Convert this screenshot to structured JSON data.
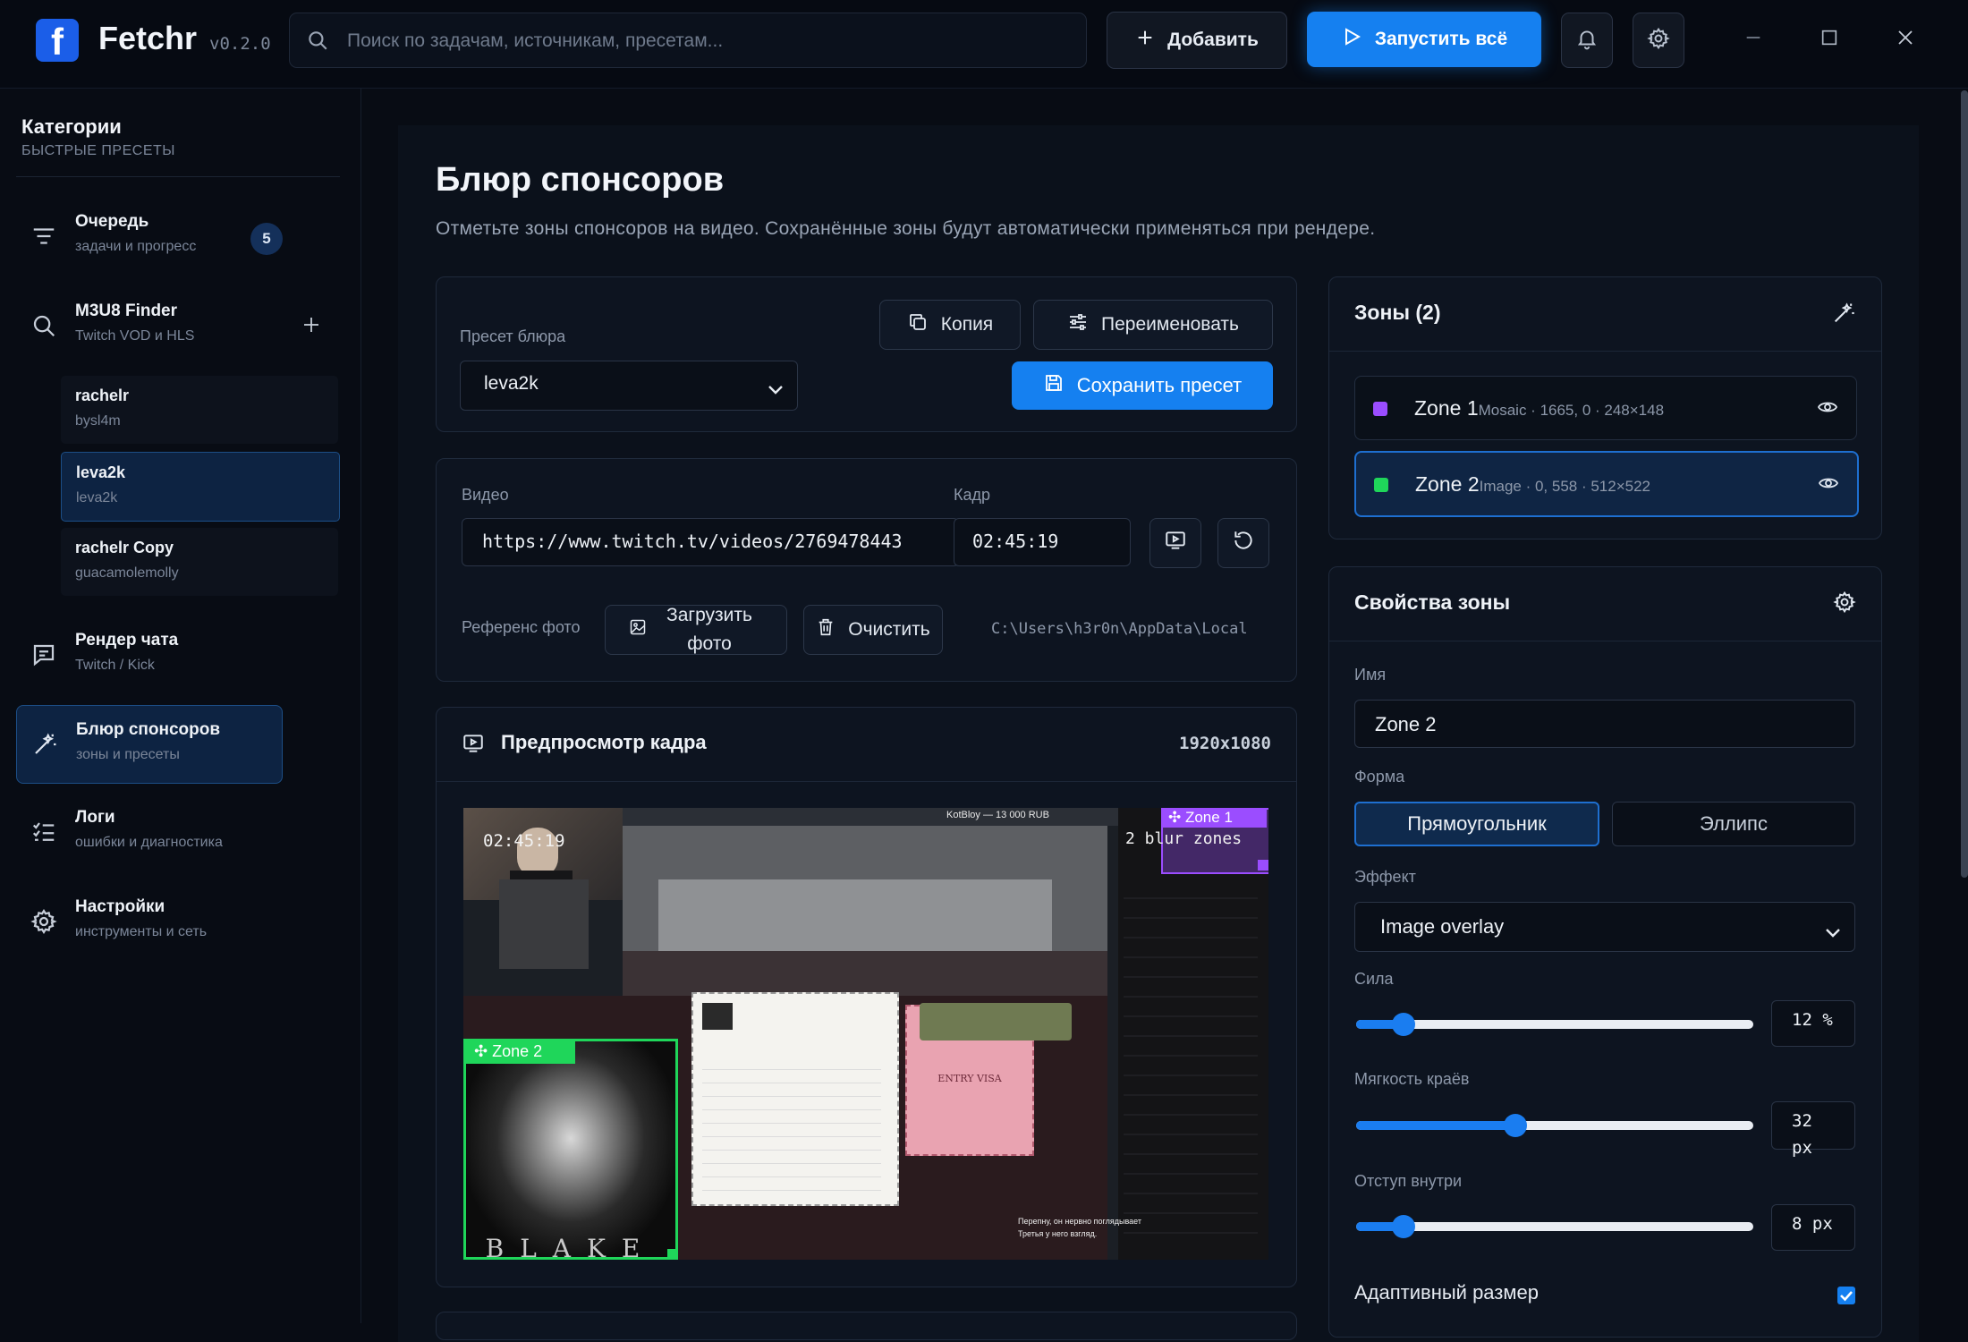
{
  "app": {
    "name": "Fetchr",
    "version": "v0.2.0",
    "logo_letter": "f"
  },
  "search": {
    "placeholder": "Поиск по задачам, источникам, пресетам..."
  },
  "toolbar": {
    "add_label": "Добавить",
    "run_all_label": "Запустить всё"
  },
  "sidebar": {
    "title": "Категории",
    "subtitle": "БЫСТРЫЕ ПРЕСЕТЫ",
    "queue": {
      "label": "Очередь",
      "sub": "задачи и прогресс",
      "badge": "5"
    },
    "m3u8": {
      "label": "M3U8 Finder",
      "sub": "Twitch VOD и HLS"
    },
    "m3u8_items": [
      {
        "name": "rachelr",
        "sub": "bysl4m"
      },
      {
        "name": "leva2k",
        "sub": "leva2k"
      },
      {
        "name": "rachelr Copy",
        "sub": "guacamolemolly"
      }
    ],
    "chat": {
      "label": "Рендер чата",
      "sub": "Twitch / Kick"
    },
    "blur": {
      "label": "Блюр спонсоров",
      "sub": "зоны и пресеты"
    },
    "logs": {
      "label": "Логи",
      "sub": "ошибки и диагностика"
    },
    "settings": {
      "label": "Настройки",
      "sub": "инструменты и сеть"
    }
  },
  "page": {
    "title": "Блюр спонсоров",
    "description": "Отметьте зоны спонсоров на видео. Сохранённые зоны будут автоматически применяться при рендере."
  },
  "preset": {
    "label": "Пресет блюра",
    "selected": "leva2k",
    "copy_label": "Копия",
    "rename_label": "Переименовать",
    "save_label": "Сохранить пресет"
  },
  "video": {
    "video_label": "Видео",
    "url": "https://www.twitch.tv/videos/2769478443",
    "frame_label": "Кадр",
    "frame": "02:45:19",
    "ref_label": "Референс фото",
    "upload_label": "Загрузить фото",
    "clear_label": "Очистить",
    "ref_path": "C:\\Users\\h3r0n\\AppData\\Local"
  },
  "preview": {
    "title": "Предпросмотр кадра",
    "resolution": "1920x1080",
    "timestamp": "02:45:19",
    "zone1_tag": "Zone 1",
    "zone2_tag": "Zone 2",
    "overlay_text": "2 blur zones",
    "art_text": "BLAKE",
    "game_banner": "KotBloy — 13 000 RUB",
    "entry_visa": "ENTRY VISA",
    "chat_line1": "Перепну, он нервно поглядывает",
    "chat_line2": "Третья у него взгляд."
  },
  "zones": {
    "title": "Зоны (2)",
    "items": [
      {
        "name": "Zone 1",
        "meta": "Mosaic · 1665, 0 · 248×148",
        "color": "#9b4dff"
      },
      {
        "name": "Zone 2",
        "meta": "Image · 0, 558 · 512×522",
        "color": "#1fd65a"
      }
    ]
  },
  "props": {
    "title": "Свойства зоны",
    "name_label": "Имя",
    "name_value": "Zone 2",
    "shape_label": "Форма",
    "shape_rect": "Прямоугольник",
    "shape_ellipse": "Эллипс",
    "effect_label": "Эффект",
    "effect_value": "Image overlay",
    "strength_label": "Сила",
    "strength_value": "12 %",
    "strength_level": 0.12,
    "soft_label": "Мягкость краёв",
    "soft_value": "32 px",
    "soft_level": 0.4,
    "padding_label": "Отступ внутри",
    "padding_value": "8 px",
    "padding_level": 0.12,
    "adaptive_label": "Адаптивный размер",
    "adaptive_checked": true
  },
  "colors": {
    "accent": "#1580f0",
    "zone1": "#9b4dff",
    "zone2": "#1fd65a"
  }
}
